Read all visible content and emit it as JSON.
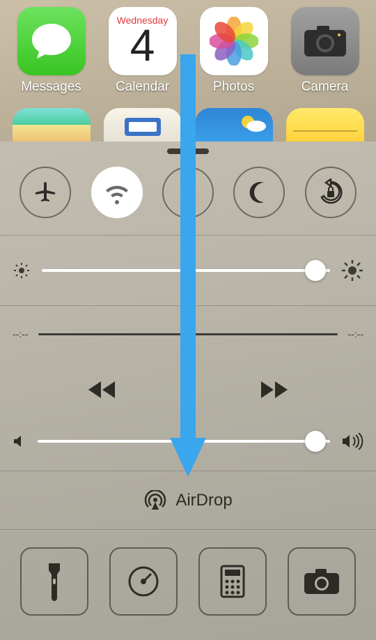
{
  "home": {
    "apps": [
      {
        "label": "Messages"
      },
      {
        "label": "Calendar",
        "day_name": "Wednesday",
        "day_num": "4"
      },
      {
        "label": "Photos"
      },
      {
        "label": "Camera"
      }
    ]
  },
  "control_center": {
    "brightness": {
      "value_pct": 95
    },
    "media": {
      "elapsed": "--:--",
      "remaining": "--:--"
    },
    "volume": {
      "value_pct": 95
    },
    "airdrop": {
      "label": "AirDrop"
    }
  },
  "annotation": {
    "arrow_color": "#3aa6ee"
  }
}
